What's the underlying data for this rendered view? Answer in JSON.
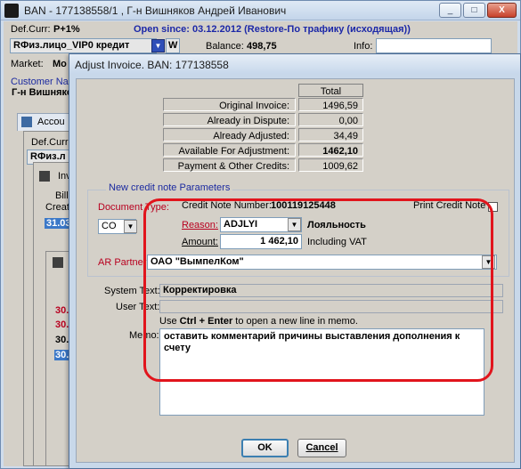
{
  "main_window": {
    "title": "BAN - 177138558/1 , Г-н Вишняков Андрей Иванович",
    "def_curr_label": "Def.Curr:",
    "def_curr_value": "P+1%",
    "open_since": "Open since: 03.12.2012 (Restore-По трафику (исходящая))",
    "account_type": "RФиз.лицо_VIP0  кредит",
    "w_button": "W",
    "balance_label": "Balance:",
    "balance_value": "498,75",
    "info_label": "Info:",
    "market_label": "Market:",
    "market_value": "Мо",
    "customer_label": "Customer Na",
    "customer_value": "Г-н Вишняко",
    "accou_tab": "Accou",
    "inner_def_curr": "Def.Curr:",
    "inner_account": "RФиз.л",
    "inv_label": "Inv",
    "bill_label": "Bill",
    "creation_label": "Creati",
    "date_selected": "31.03",
    "rows": [
      "30.0",
      "30.0",
      "30.0",
      "30.0"
    ]
  },
  "window_buttons": {
    "minimize": "_",
    "maximize": "□",
    "close": "X"
  },
  "dialog": {
    "title": "Adjust Invoice. BAN: 177138558",
    "total_header": "Total",
    "summary_rows": [
      {
        "label": "Original Invoice:",
        "value": "1496,59",
        "bold": false
      },
      {
        "label": "Already in Dispute:",
        "value": "0,00",
        "bold": false
      },
      {
        "label": "Already Adjusted:",
        "value": "34,49",
        "bold": false
      },
      {
        "label": "Available For Adjustment:",
        "value": "1462,10",
        "bold": true
      },
      {
        "label": "Payment & Other Credits:",
        "value": "1009,62",
        "bold": false
      }
    ],
    "group_title": "New credit note Parameters",
    "document_type_label": "Document Type:",
    "document_type_value": "CO",
    "credit_note_label": "Credit Note Number:",
    "credit_note_value": "100119125448",
    "print_credit_note_label": "Print Credit Note",
    "reason_label": "Reason:",
    "reason_value": "ADJLYI",
    "reason_description": "Лояльность",
    "amount_label": "Amount:",
    "amount_value": "1 462,10",
    "including_vat": "Including VAT",
    "ar_partner_label": "AR Partner",
    "ar_partner_value": "ОАО \"ВымпелКом\"",
    "system_text_label": "System Text:",
    "system_text_value": "Корректировка",
    "user_text_label": "User Text:",
    "user_text_value": "",
    "hint_use": "Use ",
    "hint_keys": "Ctrl + Enter",
    "hint_rest": " to open a new line in memo.",
    "memo_label": "Memo:",
    "memo_value": "оставить комментарий причины выставления дополнения к счету",
    "ok_label": "OK",
    "cancel_label": "Cancel"
  },
  "colors": {
    "highlight_ring": "#e1141c",
    "group_title": "#1b2aa0",
    "selection": "#3b78c8"
  }
}
